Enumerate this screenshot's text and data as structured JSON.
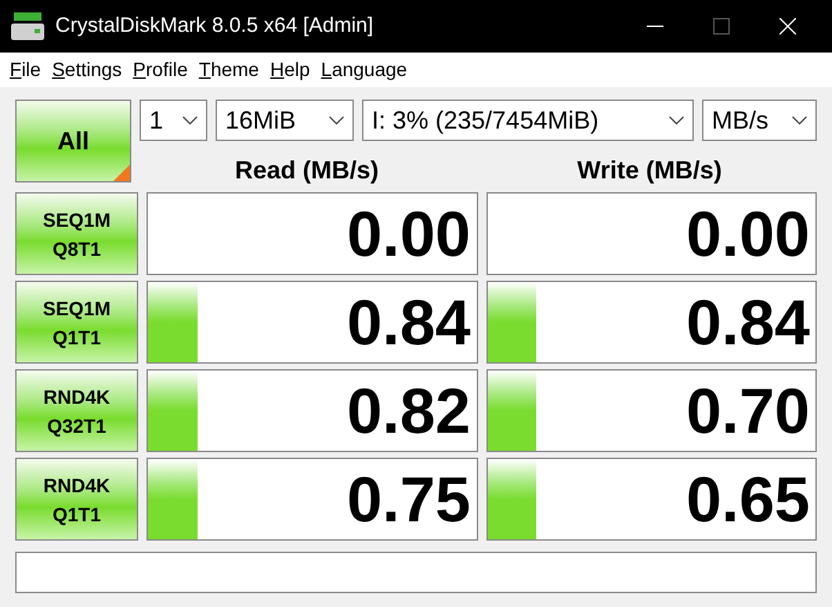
{
  "window": {
    "title": "CrystalDiskMark 8.0.5 x64 [Admin]"
  },
  "menu": [
    "File",
    "Settings",
    "Profile",
    "Theme",
    "Help",
    "Language"
  ],
  "all_button": {
    "label": "All"
  },
  "selects": [
    {
      "kind": "count",
      "value": "1"
    },
    {
      "kind": "size",
      "value": "16MiB"
    },
    {
      "kind": "drive",
      "value": "I: 3% (235/7454MiB)"
    },
    {
      "kind": "unit",
      "value": "MB/s"
    }
  ],
  "headers": [
    "Read (MB/s)",
    "Write (MB/s)"
  ],
  "tests": [
    {
      "line1": "SEQ1M",
      "line2": "Q8T1",
      "read": {
        "value": "0.00"
      },
      "write": {
        "value": "0.00"
      }
    },
    {
      "line1": "SEQ1M",
      "line2": "Q1T1",
      "read": {
        "value": "0.84",
        "level": 0.15
      },
      "write": {
        "value": "0.84",
        "level": 0.15
      }
    },
    {
      "line1": "RND4K",
      "line2": "Q32T1",
      "read": {
        "value": "0.82",
        "level": 0.15
      },
      "write": {
        "value": "0.70",
        "level": 0.15
      }
    },
    {
      "line1": "RND4K",
      "line2": "Q1T1",
      "read": {
        "value": "0.75",
        "level": 0.15
      },
      "write": {
        "value": "0.65",
        "level": 0.15
      }
    }
  ]
}
